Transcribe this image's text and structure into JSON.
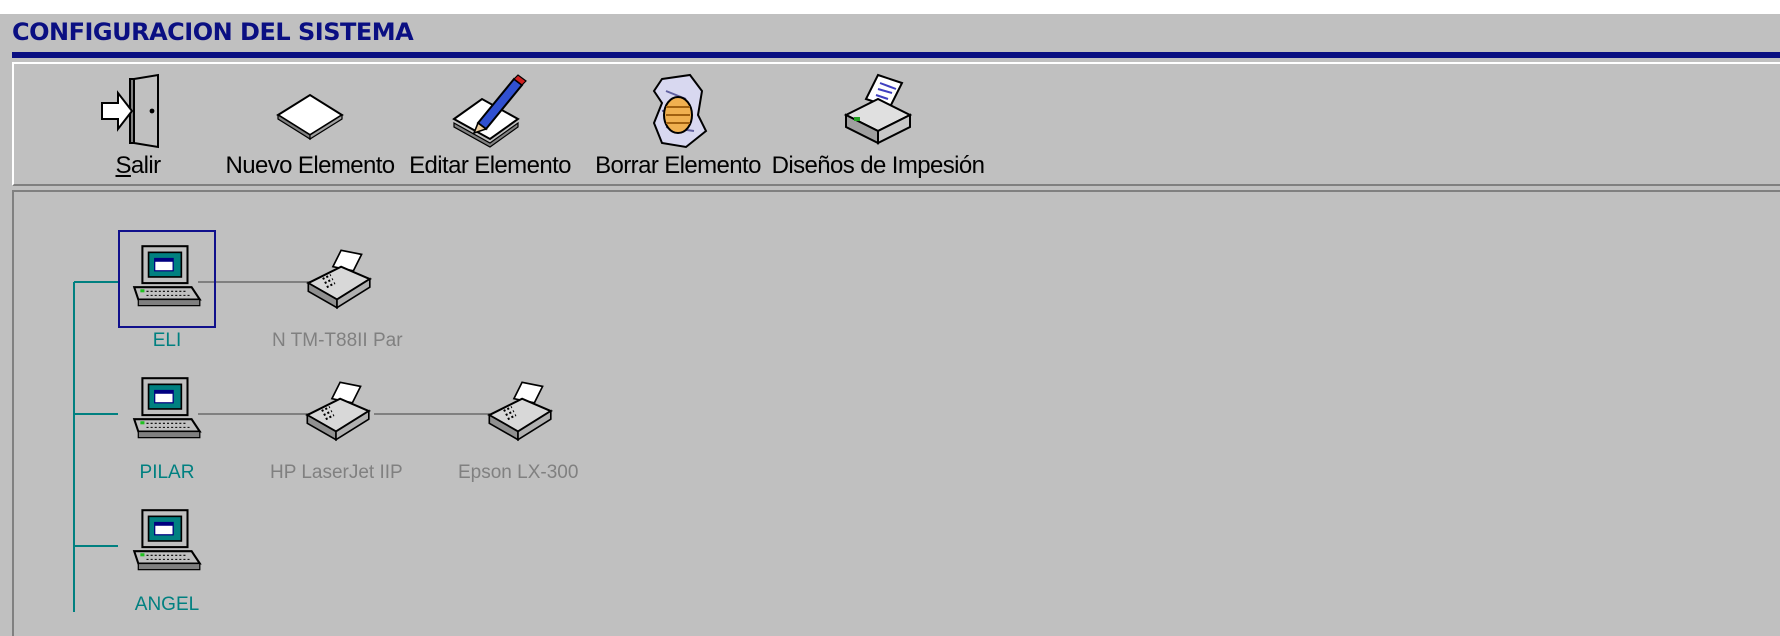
{
  "window": {
    "title": "CONFIGURACION DEL SISTEMA"
  },
  "toolbar": {
    "buttons": [
      {
        "id": "salir",
        "label_mnemonic": "S",
        "label_rest": "alir",
        "icon": "exit-door-icon"
      },
      {
        "id": "nuevo",
        "label": "Nuevo Elemento",
        "icon": "new-document-icon"
      },
      {
        "id": "editar",
        "label": "Editar Elemento",
        "icon": "edit-pencil-icon"
      },
      {
        "id": "borrar",
        "label": "Borrar Elemento",
        "icon": "crumple-delete-icon"
      },
      {
        "id": "disenos",
        "label": "Diseños de Impesión",
        "icon": "printer-icon"
      }
    ]
  },
  "network": {
    "computers": [
      {
        "name": "ELI",
        "selected": true,
        "printers": [
          "N TM-T88II Par"
        ]
      },
      {
        "name": "PILAR",
        "selected": false,
        "printers": [
          "HP LaserJet IIP",
          "Epson LX-300"
        ]
      },
      {
        "name": "ANGEL",
        "selected": false,
        "printers": []
      }
    ]
  },
  "colors": {
    "title": "#0a0f82",
    "computer_label": "#008080",
    "printer_label": "#808080",
    "tree_line_computers": "#008080",
    "tree_line_printers": "#808080",
    "selection": "#10108c"
  }
}
